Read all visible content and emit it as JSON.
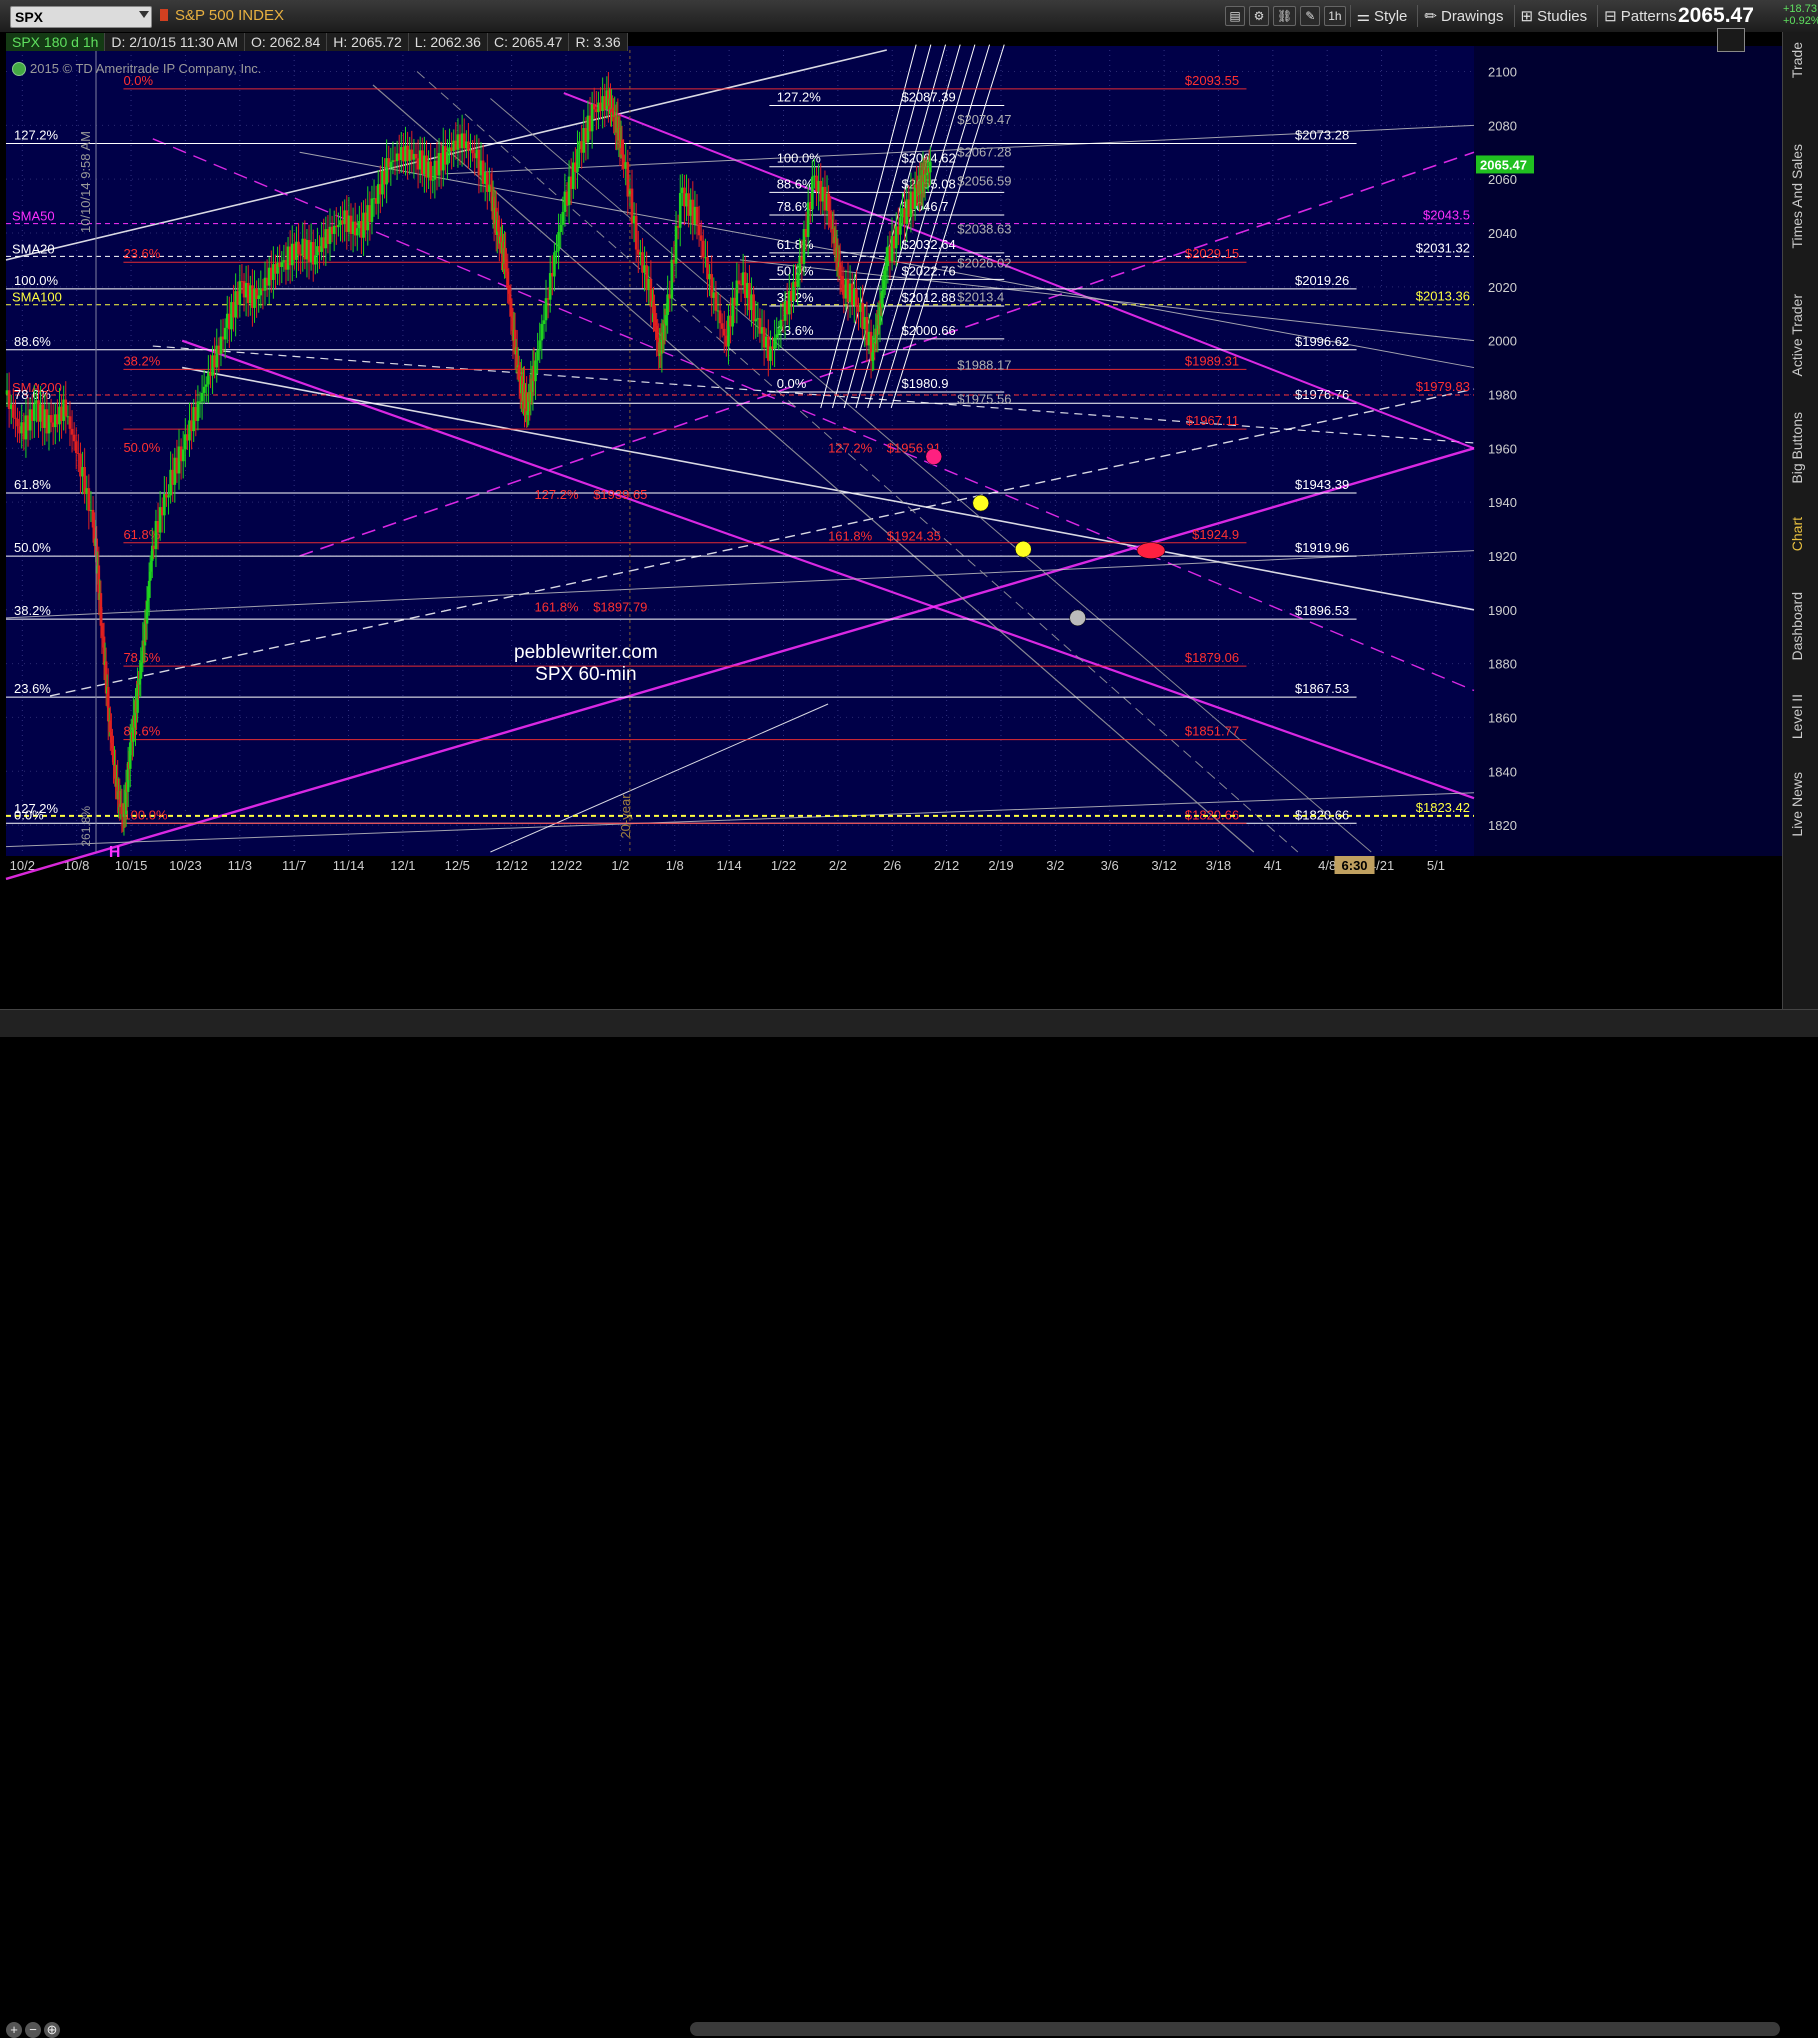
{
  "header": {
    "symbol": "SPX",
    "index_name": "S&P 500 INDEX",
    "price": "2065.47",
    "change": "+18.73",
    "change_pct": "+0.92%",
    "tool_labels": [
      "Style",
      "Drawings",
      "Studies",
      "Patterns"
    ],
    "timeframe_badge": "1h"
  },
  "infobar": {
    "symbol": "SPX 180 d 1h",
    "date": "D: 2/10/15 11:30 AM",
    "open": "O: 2062.84",
    "high": "H: 2065.72",
    "low": "L: 2062.36",
    "close": "C: 2065.47",
    "range": "R: 3.36"
  },
  "copyright": "2015 © TD Ameritrade IP Company, Inc.",
  "sidebar": [
    "Trade",
    "Times And Sales",
    "Active Trader",
    "Big Buttons",
    "Chart",
    "Dashboard",
    "Level II",
    "Live News"
  ],
  "colors": {
    "background": "#000048",
    "candle_up": "#1ed21e",
    "candle_down": "#e02020",
    "magenta": "#ff20ff",
    "fib_red": "#ff3030",
    "yellow": "#ffff40",
    "white": "#ffffff"
  },
  "chart_data": {
    "type": "candlestick",
    "watermark": [
      "pebblewriter.com",
      "SPX 60-min"
    ],
    "vertical_label_1": "10/10/14 9:58 AM",
    "vertical_label_2": "20-year",
    "vertical_label_3": "261.8%",
    "letter_H": "H",
    "ylim": [
      1810,
      2108
    ],
    "y_ticks": [
      2100,
      2080,
      2060,
      2040,
      2020,
      2000,
      1980,
      1960,
      1940,
      1920,
      1900,
      1880,
      1860,
      1840,
      1820
    ],
    "x_ticks": [
      "10/2",
      "10/8",
      "10/15",
      "10/23",
      "11/3",
      "11/7",
      "11/14",
      "12/1",
      "12/5",
      "12/12",
      "12/22",
      "1/2",
      "1/8",
      "1/14",
      "1/22",
      "2/2",
      "2/6",
      "2/12",
      "2/19",
      "3/2",
      "3/6",
      "3/12",
      "3/18",
      "4/1",
      "4/8",
      "4/21",
      "5/1"
    ],
    "time_marker": "6:30",
    "current_price_badge": "2065.47",
    "sma_labels": [
      "SMA50",
      "SMA20",
      "SMA100",
      "SMA200"
    ],
    "price_levels_white": [
      {
        "label": "$2073.28",
        "value": 2073.28
      },
      {
        "label": "$2019.26",
        "value": 2019.26
      },
      {
        "label": "$1996.62",
        "value": 1996.62
      },
      {
        "label": "$1976.76",
        "value": 1976.76
      },
      {
        "label": "$1943.39",
        "value": 1943.39
      },
      {
        "label": "$1919.96",
        "value": 1919.96
      },
      {
        "label": "$1896.53",
        "value": 1896.53
      },
      {
        "label": "$1867.53",
        "value": 1867.53
      },
      {
        "label": "$1820.66",
        "value": 1820.66
      }
    ],
    "price_levels_red": [
      {
        "label": "$2093.55",
        "value": 2093.55
      },
      {
        "label": "$2029.15",
        "value": 2029.15
      },
      {
        "label": "$1989.31",
        "value": 1989.31
      },
      {
        "label": "$1967.11",
        "value": 1967.11
      },
      {
        "label": "$1924.9",
        "value": 1924.9
      },
      {
        "label": "$1879.06",
        "value": 1879.06
      },
      {
        "label": "$1851.77",
        "value": 1851.77
      },
      {
        "label": "$1820.66",
        "value": 1820.66
      }
    ],
    "price_levels_other": [
      {
        "label": "$2043.5",
        "value": 2043.5
      },
      {
        "label": "$2031.32",
        "value": 2031.32
      },
      {
        "label": "$2013.36",
        "value": 2013.36
      },
      {
        "label": "$1979.83",
        "value": 1979.83
      },
      {
        "label": "$1823.42",
        "value": 1823.42
      }
    ],
    "fib_left_labels": [
      {
        "label": "127.2%",
        "value": 2073.28
      },
      {
        "label": "100.0%",
        "value": 2019.26
      },
      {
        "label": "88.6%",
        "value": 1996.62
      },
      {
        "label": "78.6%",
        "value": 1976.76
      },
      {
        "label": "61.8%",
        "value": 1943.39
      },
      {
        "label": "50.0%",
        "value": 1919.96
      },
      {
        "label": "38.2%",
        "value": 1896.53
      },
      {
        "label": "23.6%",
        "value": 1867.53
      },
      {
        "label": "127.2%",
        "value": 1823.0
      },
      {
        "label": "0.0%",
        "value": 1820.66
      }
    ],
    "fib_red_labels": [
      {
        "label": "0.0%",
        "value": 2093.55
      },
      {
        "label": "23.6%",
        "value": 2029.15
      },
      {
        "label": "38.2%",
        "value": 1989.31
      },
      {
        "label": "50.0%",
        "value": 1957.11
      },
      {
        "label": "61.8%",
        "value": 1924.9
      },
      {
        "label": "78.6%",
        "value": 1879.06
      },
      {
        "label": "88.6%",
        "value": 1851.77
      },
      {
        "label": "100.0%",
        "value": 1820.66
      }
    ],
    "fib_mid_white": [
      {
        "label": "127.2%",
        "price": "$2087.39",
        "value": 2087.39
      },
      {
        "label": "100.0%",
        "price": "$2064.62",
        "value": 2064.62
      },
      {
        "label": "88.6%",
        "price": "$2055.08",
        "value": 2055.08
      },
      {
        "label": "78.6%",
        "price": "$2046.7",
        "value": 2046.7
      },
      {
        "label": "61.8%",
        "price": "$2032.64",
        "value": 2032.64
      },
      {
        "label": "50.0%",
        "price": "$2022.76",
        "value": 2022.76
      },
      {
        "label": "38.2%",
        "price": "$2012.88",
        "value": 2012.88
      },
      {
        "label": "23.6%",
        "price": "$2000.66",
        "value": 2000.66
      },
      {
        "label": "0.0%",
        "price": "$1980.9",
        "value": 1980.9
      }
    ],
    "fib_lower_red": [
      {
        "label": "127.2%",
        "price": "$1956.91",
        "value": 1956.91
      },
      {
        "label": "127.2%",
        "price": "$1939.65",
        "value": 1939.65
      },
      {
        "label": "161.8%",
        "price": "$1924.35",
        "value": 1924.35
      },
      {
        "label": "161.8%",
        "price": "$1897.79",
        "value": 1897.79
      }
    ],
    "fib_grey_labels": [
      {
        "label": "$2079.47",
        "value": 2079.47
      },
      {
        "label": "$2067.28",
        "value": 2067.28
      },
      {
        "label": "$2056.59",
        "value": 2056.59
      },
      {
        "label": "$2038.63",
        "value": 2038.63
      },
      {
        "label": "$2026.02",
        "value": 2026.02
      },
      {
        "label": "$2013.4",
        "value": 2013.4
      },
      {
        "label": "$1988.17",
        "value": 1988.17
      },
      {
        "label": "$1975.56",
        "value": 1975.56
      }
    ],
    "markers": [
      {
        "color": "#ff2080",
        "x_frac": 0.632,
        "value": 1956.91
      },
      {
        "color": "#ffff20",
        "x_frac": 0.664,
        "value": 1939.65
      },
      {
        "color": "#ffff20",
        "x_frac": 0.693,
        "value": 1922.5
      },
      {
        "color": "#ff2040",
        "x_frac": 0.78,
        "value": 1922.0
      },
      {
        "color": "#bbbbbb",
        "x_frac": 0.73,
        "value": 1897.0
      }
    ],
    "price_path": [
      [
        0.0,
        1980
      ],
      [
        0.01,
        1965
      ],
      [
        0.02,
        1975
      ],
      [
        0.03,
        1968
      ],
      [
        0.04,
        1975
      ],
      [
        0.05,
        1955
      ],
      [
        0.06,
        1930
      ],
      [
        0.065,
        1895
      ],
      [
        0.07,
        1860
      ],
      [
        0.075,
        1835
      ],
      [
        0.08,
        1822
      ],
      [
        0.085,
        1850
      ],
      [
        0.09,
        1870
      ],
      [
        0.095,
        1895
      ],
      [
        0.1,
        1925
      ],
      [
        0.11,
        1945
      ],
      [
        0.12,
        1960
      ],
      [
        0.13,
        1975
      ],
      [
        0.14,
        1990
      ],
      [
        0.15,
        2005
      ],
      [
        0.16,
        2020
      ],
      [
        0.17,
        2015
      ],
      [
        0.18,
        2025
      ],
      [
        0.19,
        2030
      ],
      [
        0.2,
        2035
      ],
      [
        0.21,
        2032
      ],
      [
        0.22,
        2040
      ],
      [
        0.23,
        2045
      ],
      [
        0.24,
        2040
      ],
      [
        0.25,
        2050
      ],
      [
        0.26,
        2065
      ],
      [
        0.27,
        2070
      ],
      [
        0.28,
        2068
      ],
      [
        0.29,
        2062
      ],
      [
        0.3,
        2070
      ],
      [
        0.31,
        2075
      ],
      [
        0.32,
        2068
      ],
      [
        0.33,
        2055
      ],
      [
        0.335,
        2040
      ],
      [
        0.34,
        2030
      ],
      [
        0.345,
        2005
      ],
      [
        0.35,
        1985
      ],
      [
        0.355,
        1975
      ],
      [
        0.36,
        1990
      ],
      [
        0.37,
        2020
      ],
      [
        0.38,
        2050
      ],
      [
        0.39,
        2070
      ],
      [
        0.4,
        2085
      ],
      [
        0.41,
        2090
      ],
      [
        0.415,
        2082
      ],
      [
        0.42,
        2070
      ],
      [
        0.43,
        2035
      ],
      [
        0.44,
        2015
      ],
      [
        0.445,
        1995
      ],
      [
        0.45,
        2010
      ],
      [
        0.46,
        2055
      ],
      [
        0.47,
        2045
      ],
      [
        0.48,
        2020
      ],
      [
        0.49,
        2000
      ],
      [
        0.5,
        2025
      ],
      [
        0.51,
        2010
      ],
      [
        0.52,
        1995
      ],
      [
        0.53,
        2010
      ],
      [
        0.54,
        2025
      ],
      [
        0.55,
        2060
      ],
      [
        0.56,
        2050
      ],
      [
        0.565,
        2035
      ],
      [
        0.57,
        2020
      ],
      [
        0.58,
        2015
      ],
      [
        0.59,
        1995
      ],
      [
        0.595,
        2010
      ],
      [
        0.6,
        2030
      ],
      [
        0.61,
        2045
      ],
      [
        0.62,
        2055
      ],
      [
        0.625,
        2060
      ],
      [
        0.63,
        2065
      ]
    ]
  }
}
